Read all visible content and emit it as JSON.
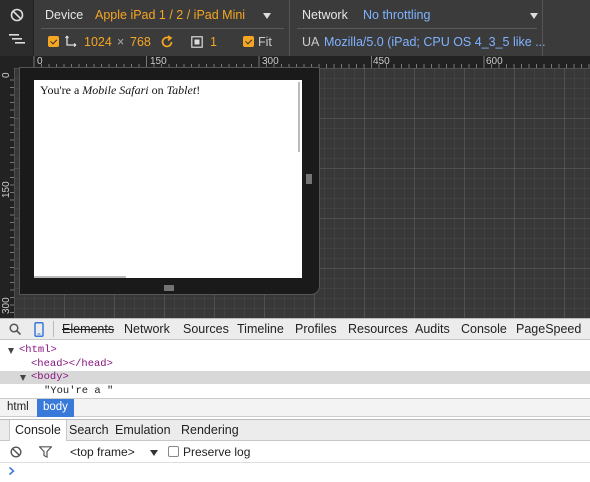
{
  "emulation": {
    "device_label": "Device",
    "device_value": "Apple iPad 1 / 2 / iPad Mini",
    "width": "1024",
    "times": "×",
    "height": "768",
    "scale_value": "1",
    "fit_label": "Fit",
    "network_label": "Network",
    "network_value": "No throttling",
    "ua_label": "UA",
    "ua_value": "Mozilla/5.0 (iPad; CPU OS 4_3_5 like ..."
  },
  "rulers": {
    "top": [
      "0",
      "150",
      "300",
      "450",
      "600"
    ],
    "left": [
      "0",
      "150",
      "300"
    ]
  },
  "page": {
    "text_prefix": "You're a ",
    "text_em1": "Mobile Safari",
    "text_mid": " on ",
    "text_em2": "Tablet",
    "text_suffix": "!"
  },
  "devtools": {
    "tabs": [
      "Elements",
      "Network",
      "Sources",
      "Timeline",
      "Profiles",
      "Resources",
      "Audits",
      "Console",
      "PageSpeed"
    ]
  },
  "dom": {
    "html_open": "<html>",
    "head": "<head></head>",
    "body_open": "<body>",
    "text_node": "\"You're a \""
  },
  "breadcrumbs": [
    "html",
    "body"
  ],
  "drawer": {
    "tabs": [
      "Console",
      "Search",
      "Emulation",
      "Rendering"
    ],
    "frame_label": "<top frame>",
    "preserve_log": "Preserve log"
  },
  "colors": {
    "accent_orange": "#f5a623",
    "ua_blue": "#7fb3ff",
    "selection_blue": "#3879d9"
  }
}
